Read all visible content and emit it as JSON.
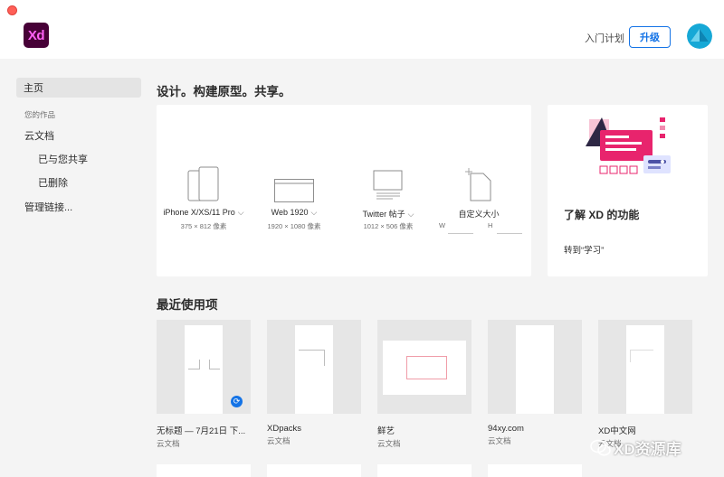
{
  "app": {
    "logo_text": "Xd",
    "brand_color": "#470137",
    "logo_text_color": "#ff61f6"
  },
  "header": {
    "learn_link": "入门计划",
    "upgrade_label": "升级",
    "accent_color": "#1473e6"
  },
  "sidebar": {
    "home": "主页",
    "section_label": "您的作品",
    "cloud_docs": "云文档",
    "shared_with_you": "已与您共享",
    "deleted": "已删除",
    "manage_links": "管理链接..."
  },
  "main": {
    "hero_title": "设计。构建原型。共享。",
    "presets": [
      {
        "label": "iPhone X/XS/11 Pro",
        "size": "375 × 812 像素",
        "icon": "phone-icon"
      },
      {
        "label": "Web 1920",
        "size": "1920 × 1080 像素",
        "icon": "browser-window-icon"
      },
      {
        "label": "Twitter 帖子",
        "size": "1012 × 506 像素",
        "icon": "social-post-icon"
      },
      {
        "label": "自定义大小",
        "w_label": "W",
        "h_label": "H",
        "icon": "custom-size-icon"
      }
    ],
    "learn": {
      "title": "了解 XD 的功能",
      "link": "转到“学习”"
    },
    "recent_title": "最近使用项",
    "recent": [
      {
        "name": "无标题 — 7月21日 下...",
        "location": "云文档"
      },
      {
        "name": "XDpacks",
        "location": "云文档"
      },
      {
        "name": "鲜艺",
        "location": "云文档"
      },
      {
        "name": "94xy.com",
        "location": "云文档"
      },
      {
        "name": "XD中文网",
        "location": "云文档"
      }
    ]
  },
  "watermark": {
    "text": "XD资源库"
  }
}
